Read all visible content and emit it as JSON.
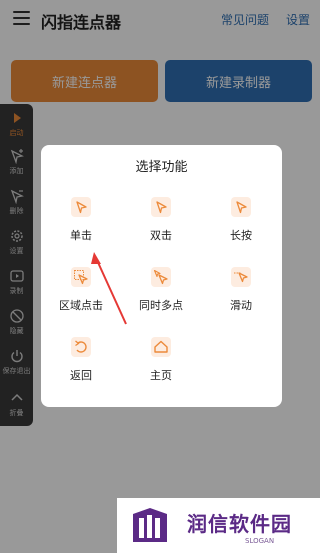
{
  "header": {
    "title": "闪指连点器",
    "faq": "常见问题",
    "settings": "设置"
  },
  "actions": {
    "new_clicker": "新建连点器",
    "new_recorder": "新建录制器"
  },
  "toolbar": {
    "items": [
      {
        "label": "启动",
        "icon": "play-icon"
      },
      {
        "label": "添加",
        "icon": "add-pointer-icon"
      },
      {
        "label": "删除",
        "icon": "remove-pointer-icon"
      },
      {
        "label": "设置",
        "icon": "gear-icon"
      },
      {
        "label": "录制",
        "icon": "record-icon"
      },
      {
        "label": "隐藏",
        "icon": "hide-icon"
      },
      {
        "label": "保存退出",
        "icon": "power-icon"
      },
      {
        "label": "折叠",
        "icon": "chevron-up-icon"
      }
    ]
  },
  "dialog": {
    "title": "选择功能",
    "options": [
      {
        "label": "单击",
        "icon": "single-click-icon"
      },
      {
        "label": "双击",
        "icon": "double-click-icon"
      },
      {
        "label": "长按",
        "icon": "long-press-icon"
      },
      {
        "label": "区域点击",
        "icon": "area-click-icon"
      },
      {
        "label": "同时多点",
        "icon": "multi-point-icon"
      },
      {
        "label": "滑动",
        "icon": "swipe-icon"
      },
      {
        "label": "返回",
        "icon": "back-icon"
      },
      {
        "label": "主页",
        "icon": "home-icon"
      }
    ]
  },
  "watermark": {
    "name": "润信软件园",
    "slogan": "SLOGAN"
  },
  "colors": {
    "accent_orange": "#ec8a3a",
    "accent_blue": "#2f6fb3",
    "arrow_red": "#e53935",
    "brand_purple": "#5b2a86"
  }
}
